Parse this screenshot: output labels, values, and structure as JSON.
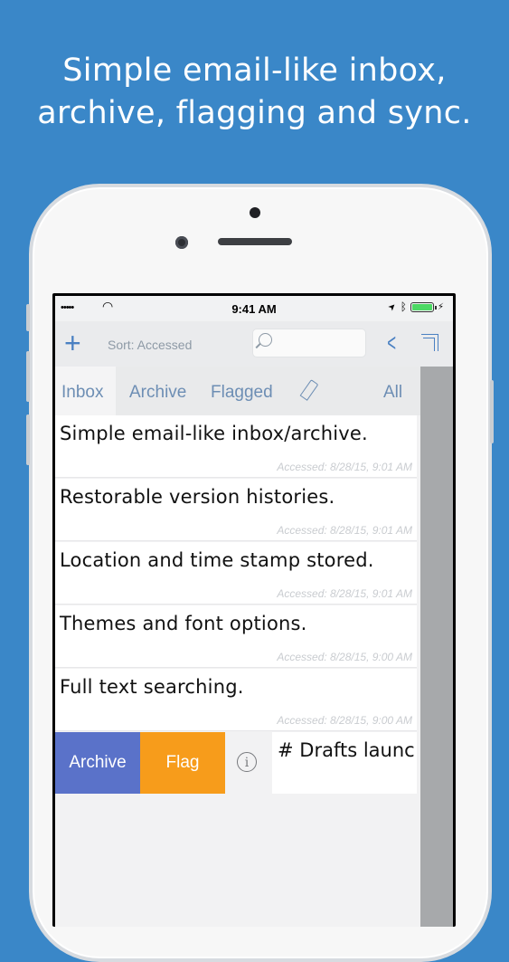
{
  "headline": {
    "line1": "Simple email-like inbox,",
    "line2": "archive, flagging and sync."
  },
  "status_bar": {
    "signal": "•••••",
    "wifi": "◠",
    "time": "9:41 AM",
    "location": "➤",
    "bluetooth": "ᛒ",
    "battery_level": 1.0
  },
  "toolbar": {
    "add": "+",
    "sort_label": "Sort: Accessed",
    "search_placeholder": "",
    "back": "<"
  },
  "tabs": {
    "inbox": "Inbox",
    "archive": "Archive",
    "flagged": "Flagged",
    "all": "All"
  },
  "drafts": [
    {
      "title": "Simple email-like inbox/archive.",
      "meta": "Accessed: 8/28/15, 9:01 AM"
    },
    {
      "title": "Restorable version histories.",
      "meta": "Accessed: 8/28/15, 9:01 AM"
    },
    {
      "title": "Location and time stamp stored.",
      "meta": "Accessed: 8/28/15, 9:01 AM"
    },
    {
      "title": "Themes and font options.",
      "meta": "Accessed: 8/28/15, 9:00 AM"
    },
    {
      "title": "Full text searching.",
      "meta": "Accessed: 8/28/15, 9:00 AM"
    }
  ],
  "swipe_actions": {
    "archive": "Archive",
    "flag": "Flag",
    "info": "i",
    "row_title": "# Drafts launc"
  },
  "colors": {
    "background": "#3a87c8",
    "accent": "#4a80c2",
    "archive_action": "#5a72c9",
    "flag_action": "#f79c1b"
  }
}
